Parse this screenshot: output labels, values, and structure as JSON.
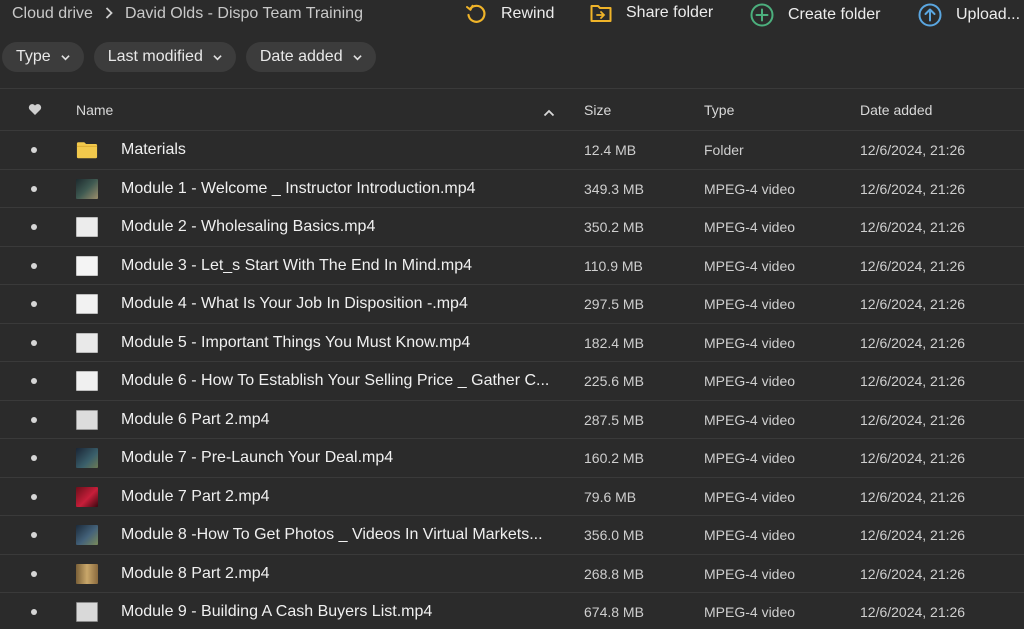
{
  "breadcrumb": {
    "root": "Cloud drive",
    "current": "David Olds - Dispo Team Training"
  },
  "actions": {
    "rewind": "Rewind",
    "share_folder": "Share folder",
    "create_folder": "Create folder",
    "upload": "Upload..."
  },
  "filters": {
    "type": "Type",
    "last_modified": "Last modified",
    "date_added": "Date added"
  },
  "table": {
    "columns": {
      "name": "Name",
      "size": "Size",
      "type": "Type",
      "date": "Date added"
    },
    "rows": [
      {
        "name": "Materials",
        "size": "12.4 MB",
        "type": "Folder",
        "date": "12/6/2024, 21:26",
        "icon": "folder-icon"
      },
      {
        "name": "Module 1 - Welcome _ Instructor Introduction.mp4",
        "size": "349.3 MB",
        "type": "MPEG-4 video",
        "date": "12/6/2024, 21:26",
        "icon": "video-thumbnail-icon"
      },
      {
        "name": "Module 2 - Wholesaling Basics.mp4",
        "size": "350.2 MB",
        "type": "MPEG-4 video",
        "date": "12/6/2024, 21:26",
        "icon": "video-thumbnail-icon"
      },
      {
        "name": "Module 3 - Let_s Start With The End In Mind.mp4",
        "size": "110.9 MB",
        "type": "MPEG-4 video",
        "date": "12/6/2024, 21:26",
        "icon": "video-thumbnail-icon"
      },
      {
        "name": "Module 4 - What Is Your Job In Disposition -.mp4",
        "size": "297.5 MB",
        "type": "MPEG-4 video",
        "date": "12/6/2024, 21:26",
        "icon": "video-thumbnail-icon"
      },
      {
        "name": "Module 5 - Important Things You Must Know.mp4",
        "size": "182.4 MB",
        "type": "MPEG-4 video",
        "date": "12/6/2024, 21:26",
        "icon": "video-thumbnail-icon"
      },
      {
        "name": "Module 6 - How To Establish Your Selling Price _ Gather C...",
        "size": "225.6 MB",
        "type": "MPEG-4 video",
        "date": "12/6/2024, 21:26",
        "icon": "video-thumbnail-icon"
      },
      {
        "name": "Module 6 Part 2.mp4",
        "size": "287.5 MB",
        "type": "MPEG-4 video",
        "date": "12/6/2024, 21:26",
        "icon": "video-thumbnail-icon"
      },
      {
        "name": "Module 7 - Pre-Launch Your Deal.mp4",
        "size": "160.2 MB",
        "type": "MPEG-4 video",
        "date": "12/6/2024, 21:26",
        "icon": "video-thumbnail-icon"
      },
      {
        "name": "Module 7 Part 2.mp4",
        "size": "79.6 MB",
        "type": "MPEG-4 video",
        "date": "12/6/2024, 21:26",
        "icon": "video-thumbnail-icon"
      },
      {
        "name": "Module 8 -How To Get Photos _ Videos In Virtual Markets...",
        "size": "356.0 MB",
        "type": "MPEG-4 video",
        "date": "12/6/2024, 21:26",
        "icon": "video-thumbnail-icon"
      },
      {
        "name": "Module 8 Part 2.mp4",
        "size": "268.8 MB",
        "type": "MPEG-4 video",
        "date": "12/6/2024, 21:26",
        "icon": "video-thumbnail-icon"
      },
      {
        "name": "Module 9 - Building A Cash Buyers List.mp4",
        "size": "674.8 MB",
        "type": "MPEG-4 video",
        "date": "12/6/2024, 21:26",
        "icon": "video-thumbnail-icon"
      }
    ]
  },
  "colors": {
    "background": "#2b2b2b",
    "chip": "#3c3c3c",
    "rewind_icon": "#f0b429",
    "share_icon": "#f0b429",
    "create_icon": "#4caf7d",
    "upload_icon": "#5aa6e0",
    "folder": "#f2c94c"
  }
}
